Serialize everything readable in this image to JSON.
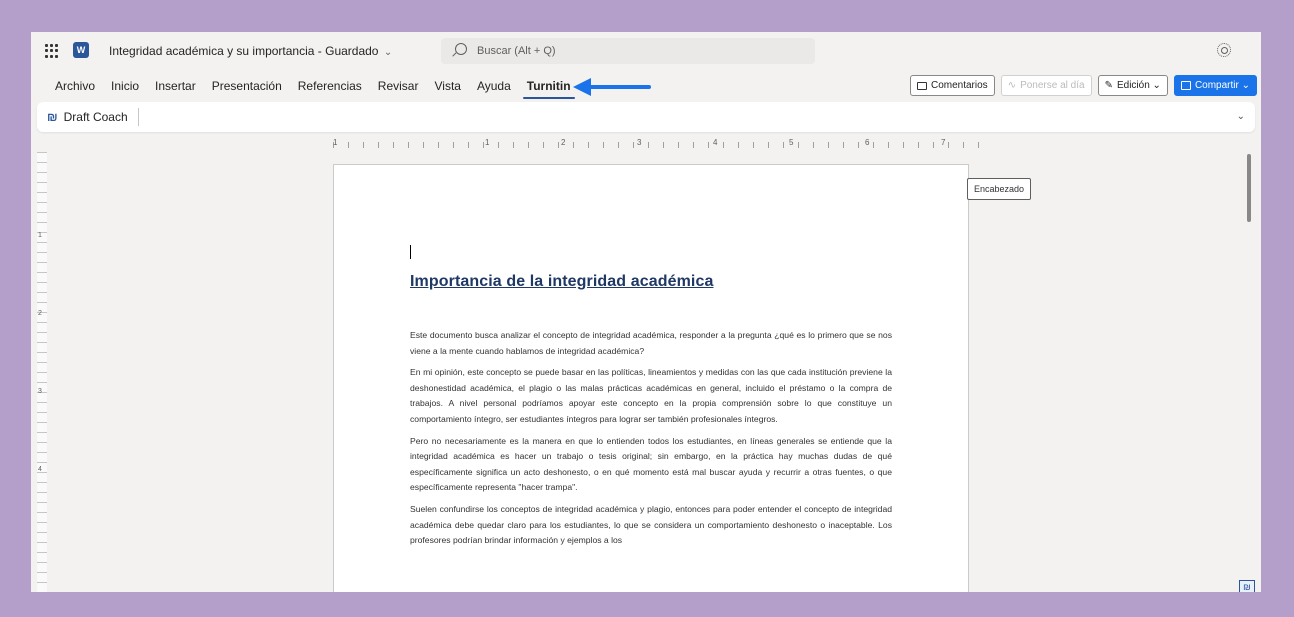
{
  "app": {
    "title": "Integridad académica y su importancia - Guardado",
    "title_chevron": "⌄",
    "logo_letter": "W"
  },
  "search": {
    "placeholder": "Buscar (Alt + Q)"
  },
  "menu": {
    "tabs": [
      {
        "label": "Archivo",
        "active": false
      },
      {
        "label": "Inicio",
        "active": false
      },
      {
        "label": "Insertar",
        "active": false
      },
      {
        "label": "Presentación",
        "active": false
      },
      {
        "label": "Referencias",
        "active": false
      },
      {
        "label": "Revisar",
        "active": false
      },
      {
        "label": "Vista",
        "active": false
      },
      {
        "label": "Ayuda",
        "active": false
      },
      {
        "label": "Turnitin",
        "active": true
      }
    ],
    "comments_label": "Comentarios",
    "catchup_label": "Ponerse al día",
    "editing_label": "Edición ⌄",
    "share_label": "Compartir ⌄"
  },
  "ribbon": {
    "draft_coach_icon": "₪",
    "draft_coach_label": "Draft Coach",
    "collapse_glyph": "⌄"
  },
  "ruler": {
    "h_numbers": [
      "1",
      "1",
      "2",
      "3",
      "4",
      "5",
      "6",
      "7"
    ],
    "v_numbers": [
      "1",
      "2",
      "3",
      "4"
    ]
  },
  "document": {
    "heading": "Importancia de la integridad académica",
    "header_tag": "Encabezado",
    "paragraphs": [
      "Este documento busca analizar el concepto de integridad académica, responder a la pregunta ¿qué es lo primero que se nos viene a la mente cuando hablamos de integridad académica?",
      "En mi opinión, este concepto se puede basar en las políticas, lineamientos y medidas con las que cada institución previene la deshonestidad académica, el plagio o las malas prácticas académicas en general, incluido el préstamo o la compra de trabajos. A nivel personal podríamos apoyar este concepto en la propia comprensión sobre lo que constituye un comportamiento íntegro, ser estudiantes íntegros para lograr ser también profesionales íntegros.",
      "Pero no necesariamente es la manera en que lo entienden todos los estudiantes, en líneas generales se entiende que la integridad académica es hacer un trabajo o tesis original; sin embargo, en la práctica hay muchas dudas de qué específicamente significa un acto deshonesto, o en qué momento está mal buscar ayuda y recurrir a otras fuentes, o que específicamente representa \"hacer trampa\".",
      "Suelen confundirse los conceptos de integridad académica y plagio, entonces para poder entender el concepto de integridad académica debe quedar claro para los estudiantes, lo que se considera un comportamiento deshonesto o inaceptable. Los profesores podrían brindar información y ejemplos a los"
    ]
  },
  "colors": {
    "frame": "#b39fc9",
    "accent": "#2b579a",
    "share": "#1a73e8",
    "arrow": "#1a73e8"
  }
}
